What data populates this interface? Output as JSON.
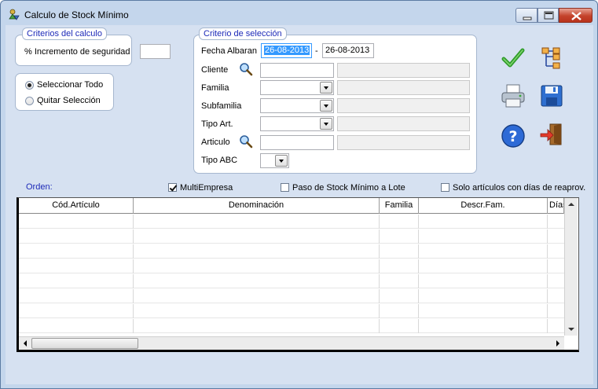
{
  "window": {
    "title": "Calculo de Stock Mínimo"
  },
  "criterios": {
    "title": "Criterios del calculo",
    "incremento_label": "% Incremento de seguridad",
    "incremento_value": ""
  },
  "seleccion_radio": {
    "option_all": "Seleccionar Todo",
    "option_none": "Quitar Selección",
    "selected": "Seleccionar Todo"
  },
  "criterio_seleccion": {
    "title": "Criterio de selección",
    "fecha_label": "Fecha Albaran",
    "fecha_desde": "26-08-2013",
    "fecha_sep": "-",
    "fecha_hasta": "26-08-2013",
    "cliente_label": "Cliente",
    "cliente_value": "",
    "cliente_desc": "",
    "familia_label": "Familia",
    "familia_value": "",
    "familia_desc": "",
    "subfamilia_label": "Subfamilia",
    "subfamilia_value": "",
    "subfamilia_desc": "",
    "tipoart_label": "Tipo Art.",
    "tipoart_value": "",
    "tipoart_desc": "",
    "articulo_label": "Articulo",
    "articulo_value": "",
    "articulo_desc": "",
    "tipoabc_label": "Tipo ABC",
    "tipoabc_value": ""
  },
  "toolbar": {
    "accept_icon": "check-icon",
    "tree_icon": "tree-icon",
    "print_icon": "printer-icon",
    "save_icon": "floppy-icon",
    "help_icon": "help-icon",
    "exit_icon": "exit-door-icon"
  },
  "options": {
    "orden_label": "Orden:",
    "multiempresa_label": "MultiEmpresa",
    "multiempresa_checked": true,
    "paso_label": "Paso de Stock Mínimo a Lote",
    "paso_checked": false,
    "solo_label": "Solo artículos con días de reaprov.",
    "solo_checked": false
  },
  "grid": {
    "columns": [
      "Cód.Artículo",
      "Denominación",
      "Familia",
      "Descr.Fam.",
      "Días"
    ],
    "rows": 8
  },
  "colors": {
    "window_bg": "#d6e1f1",
    "group_title": "#1d2ab8",
    "selection": "#3399ff"
  }
}
